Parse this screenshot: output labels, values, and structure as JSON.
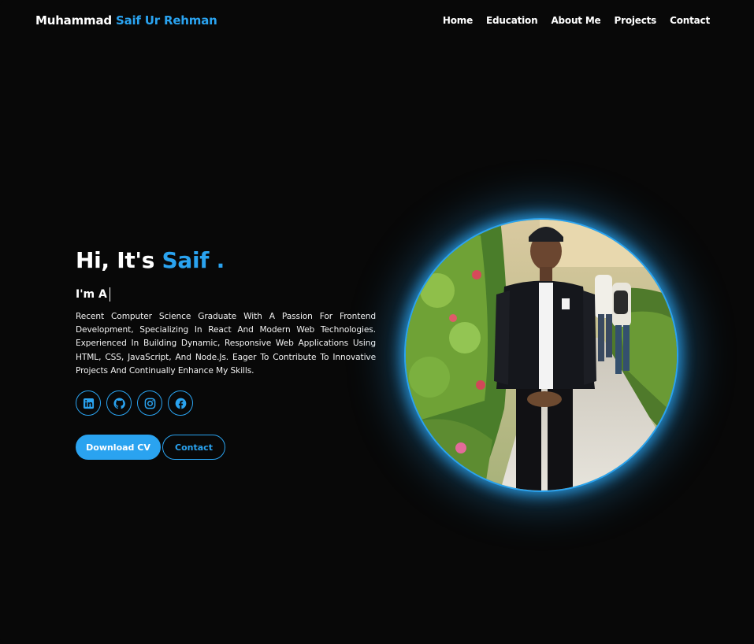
{
  "header": {
    "logo_first": "Muhammad",
    "logo_accent": "Saif Ur Rehman",
    "nav": [
      "Home",
      "Education",
      "About Me",
      "Projects",
      "Contact"
    ]
  },
  "hero": {
    "greeting": "Hi, It's",
    "name": "Saif .",
    "typing_prefix": "I'm A",
    "bio": "Recent Computer Science Graduate With A Passion For Frontend Development, Specializing In React And Modern Web Technologies. Experienced In Building Dynamic, Responsive Web Applications Using HTML, CSS, JavaScript, And Node.Js. Eager To Contribute To Innovative Projects And Continually Enhance My Skills.",
    "socials": [
      "linkedin-icon",
      "github-icon",
      "instagram-icon",
      "facebook-icon"
    ],
    "buttons": {
      "primary": "Download CV",
      "secondary": "Contact"
    }
  },
  "colors": {
    "accent": "#2aa3f0",
    "background": "#080808",
    "text": "#ffffff"
  }
}
